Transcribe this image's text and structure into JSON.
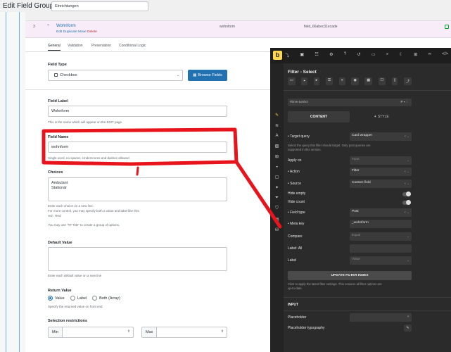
{
  "header": {
    "title": "Edit Field Group",
    "group_name": "Einrichtungen"
  },
  "field_row": {
    "order": "3",
    "label": "Wohnform",
    "actions": {
      "edit": "Edit",
      "duplicate": "Duplicate",
      "move": "Move",
      "delete": "Delete"
    },
    "name": "wohnform",
    "key": "field_66abec31ecade"
  },
  "tabs": [
    {
      "label": "General"
    },
    {
      "label": "Validation"
    },
    {
      "label": "Presentation"
    },
    {
      "label": "Conditional Logic"
    }
  ],
  "field_type": {
    "label": "Field Type",
    "value": "Checkbox",
    "browse_label": "Browse Fields"
  },
  "field_label": {
    "label": "Field Label",
    "value": "Wohnform",
    "hint": "This is the name which will appear on the EDIT page"
  },
  "field_name": {
    "label": "Field Name",
    "value": "wohnform",
    "hint": "Single word, no spaces. Underscores and dashes allowed"
  },
  "choices": {
    "label": "Choices",
    "line1": "Ambulant",
    "line2": "Stationär",
    "hint1": "Enter each choice on a new line.",
    "hint2": "For more control, you may specify both a value and label like this:",
    "hint3": "red : Red",
    "hint4": "You may use \"## Title\" to create a group of options."
  },
  "default_value": {
    "label": "Default Value",
    "hint": "Enter each default value on a new line"
  },
  "return_value": {
    "label": "Return Value",
    "options": [
      "Value",
      "Label",
      "Both (Array)"
    ],
    "hint": "Specify the returned value on front end"
  },
  "selection": {
    "label": "Selection restrictions",
    "min_label": "Min",
    "max_label": "Max"
  },
  "bricks": {
    "logo": "b",
    "panel_title": "Filter - Select",
    "element_name": "#brxe-tumlxs",
    "tab_content": "CONTENT",
    "tab_style": "STYLE",
    "target_query": {
      "label": "Target query",
      "value": "Card wrapper"
    },
    "target_hint1": "Select the query this filter should target. Only post queries are",
    "target_hint2": "supported in this version.",
    "apply_on": {
      "label": "Apply on",
      "value": "Input"
    },
    "action": {
      "label": "Action",
      "value": "Filter"
    },
    "source": {
      "label": "Source",
      "value": "Custom field"
    },
    "hide_empty": "Hide empty",
    "hide_count": "Hide count",
    "field_type": {
      "label": "Field type",
      "value": "Post"
    },
    "meta_key": {
      "label": "Meta key",
      "value": "_wohnform"
    },
    "compare": {
      "label": "Compare",
      "value": "Equal"
    },
    "label_all": "Label: All",
    "label": {
      "label": "Label",
      "value": "Value"
    },
    "update_btn": "UPDATE FILTER INDEX",
    "update_hint1": "Click to apply the latest filter settings. This ensures all filter options are",
    "update_hint2": "up-to-date.",
    "input_section": "INPUT",
    "placeholder": "Placeholder",
    "placeholder_typo": "Placeholder typography"
  },
  "colors": {
    "wp_blue": "#2271b1",
    "annotation_red": "#e8141b",
    "bricks_accent": "#ffd64f",
    "row_highlight": "#f7ecf8"
  }
}
